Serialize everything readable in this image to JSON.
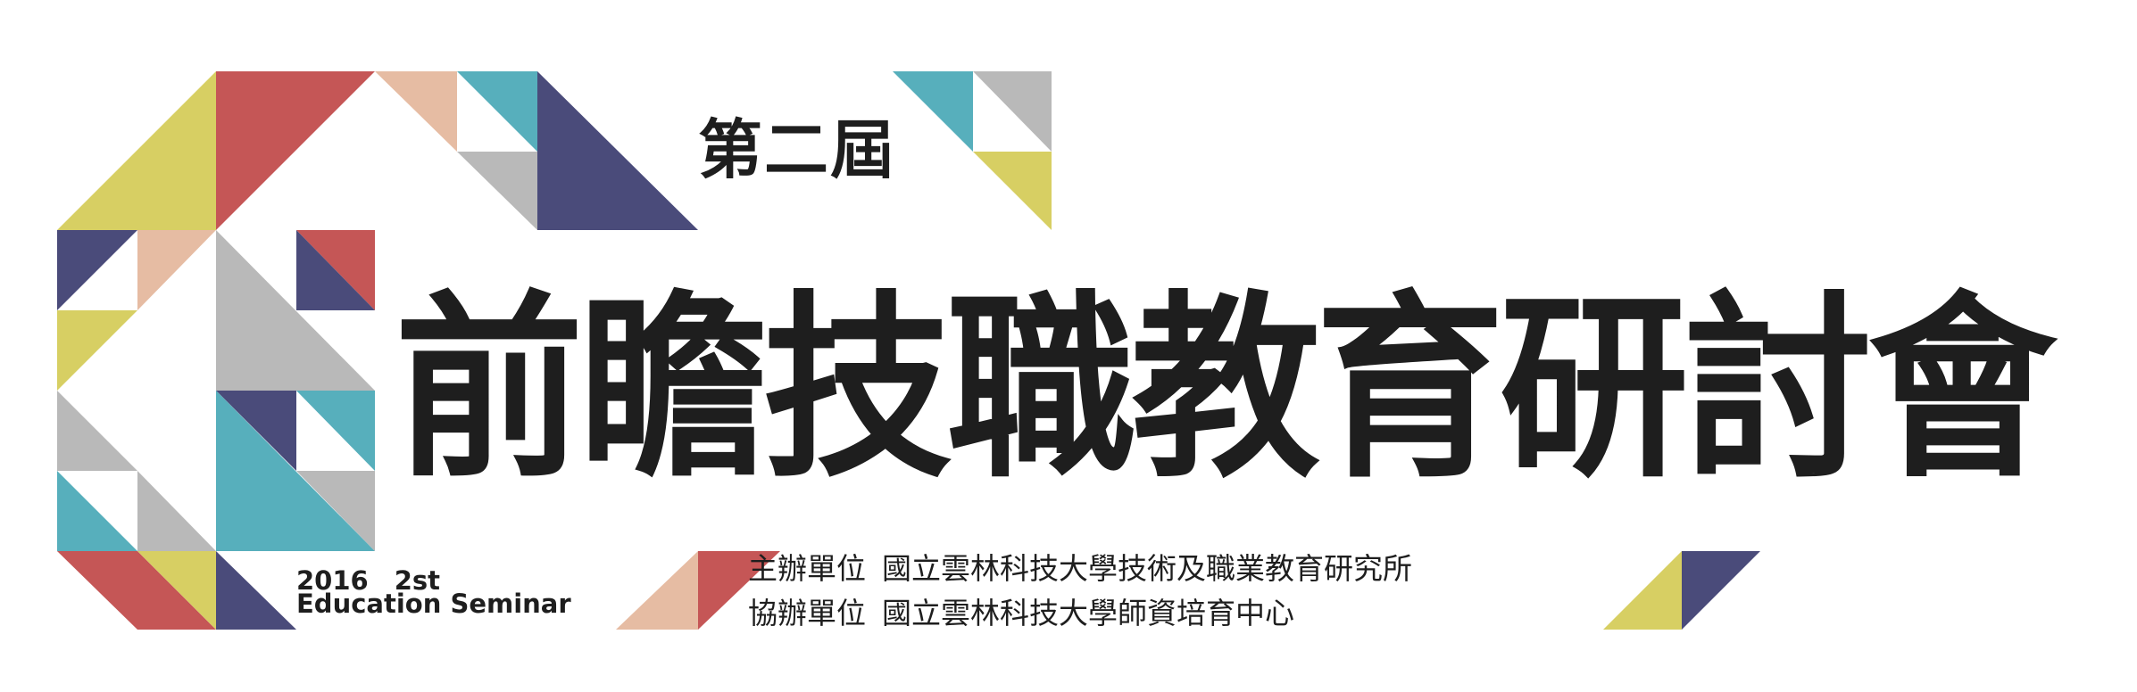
{
  "edition": "第二屆",
  "title": "前瞻技職教育研討會",
  "organizer": {
    "label": "主辦單位",
    "name": "國立雲林科技大學技術及職業教育研究所"
  },
  "co_organizer": {
    "label": "協辦單位",
    "name": "國立雲林科技大學師資培育中心"
  },
  "subtitle": {
    "year_line": "2016　2st",
    "seminar_line": "Education  Seminar"
  },
  "colors": {
    "yellow": "#d7cf63",
    "red": "#c55656",
    "navy": "#4a4b7a",
    "teal": "#57afbc",
    "peach": "#e6bca3",
    "gray": "#b9b9b9",
    "text": "#1e1e1e"
  }
}
